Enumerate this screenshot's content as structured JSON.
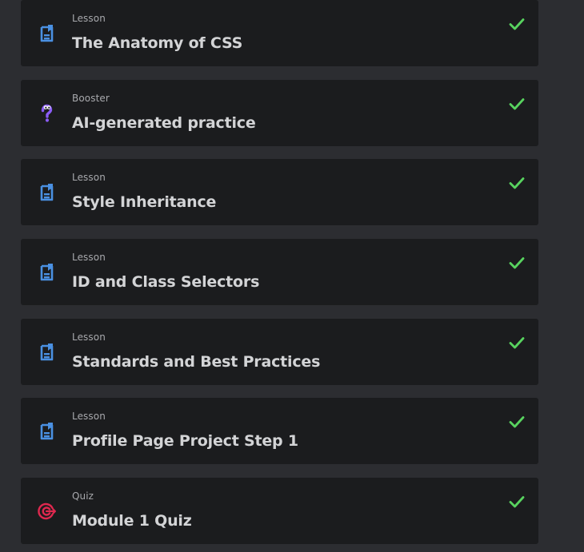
{
  "colors": {
    "page_background": "#2c2d31",
    "card_background": "#1b1c1e",
    "lesson_icon": "#4a90e2",
    "booster_icon": "#8b5cf6",
    "quiz_icon": "#e0284f",
    "check": "#58d35f"
  },
  "items": [
    {
      "kind": "Lesson",
      "title": "The Anatomy of CSS",
      "icon": "lesson-document-icon",
      "completed": true
    },
    {
      "kind": "Booster",
      "title": "AI-generated practice",
      "icon": "booster-question-icon",
      "completed": true
    },
    {
      "kind": "Lesson",
      "title": "Style Inheritance",
      "icon": "lesson-document-icon",
      "completed": true
    },
    {
      "kind": "Lesson",
      "title": "ID and Class Selectors",
      "icon": "lesson-document-icon",
      "completed": true
    },
    {
      "kind": "Lesson",
      "title": "Standards and Best Practices",
      "icon": "lesson-document-icon",
      "completed": true
    },
    {
      "kind": "Lesson",
      "title": "Profile Page Project Step 1",
      "icon": "lesson-document-icon",
      "completed": true
    },
    {
      "kind": "Quiz",
      "title": "Module 1 Quiz",
      "icon": "quiz-target-icon",
      "completed": true
    }
  ]
}
